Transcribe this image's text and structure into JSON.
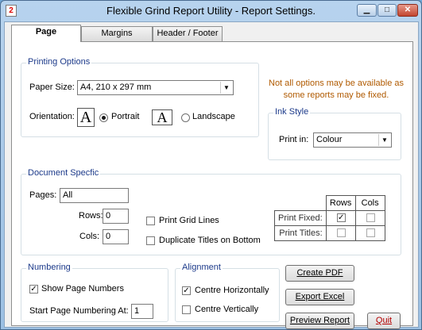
{
  "window": {
    "title": "Flexible Grind Report Utility - Report Settings.",
    "app_icon_glyph": "2",
    "min_glyph": "▁",
    "max_glyph": "□",
    "close_glyph": "✕"
  },
  "tabs": [
    {
      "label": "Page",
      "active": true
    },
    {
      "label": "Margins",
      "active": false
    },
    {
      "label": "Header / Footer",
      "active": false
    }
  ],
  "printing_options": {
    "legend": "Printing Options",
    "paper_size_label": "Paper Size:",
    "paper_size_value": "A4, 210 x 297 mm",
    "orientation_label": "Orientation:",
    "portrait_label": "Portrait",
    "landscape_label": "Landscape",
    "orientation_selected": "Portrait"
  },
  "note": {
    "line1": "Not all options may be available as",
    "line2": "some reports may be fixed."
  },
  "ink_style": {
    "legend": "Ink Style",
    "print_in_label": "Print in:",
    "print_in_value": "Colour"
  },
  "document_specific": {
    "legend": "Document Specfic",
    "pages_label": "Pages:",
    "pages_value": "All",
    "rows_label": "Rows:",
    "rows_value": "0",
    "cols_label": "Cols:",
    "cols_value": "0",
    "print_grid_lines_label": "Print Grid Lines",
    "print_grid_lines_checked": false,
    "duplicate_titles_label": "Duplicate Titles on Bottom",
    "duplicate_titles_checked": false,
    "table": {
      "col_rows": "Rows",
      "col_cols": "Cols",
      "print_fixed_label": "Print Fixed:",
      "print_titles_label": "Print Titles:",
      "print_fixed_rows": true,
      "print_fixed_cols": false,
      "print_titles_rows": false,
      "print_titles_cols": false
    }
  },
  "numbering": {
    "legend": "Numbering",
    "show_page_numbers_label": "Show Page Numbers",
    "show_page_numbers_checked": true,
    "start_at_label": "Start Page Numbering At:",
    "start_at_value": "1"
  },
  "alignment": {
    "legend": "Alignment",
    "centre_h_label": "Centre Horizontally",
    "centre_h_checked": true,
    "centre_v_label": "Centre Vertically",
    "centre_v_checked": false
  },
  "buttons": {
    "create_pdf": "Create PDF",
    "export_excel": "Export Excel",
    "preview_report": "Preview Report",
    "quit": "Quit"
  },
  "check_glyph": "✓",
  "dropdown_glyph": "▼"
}
